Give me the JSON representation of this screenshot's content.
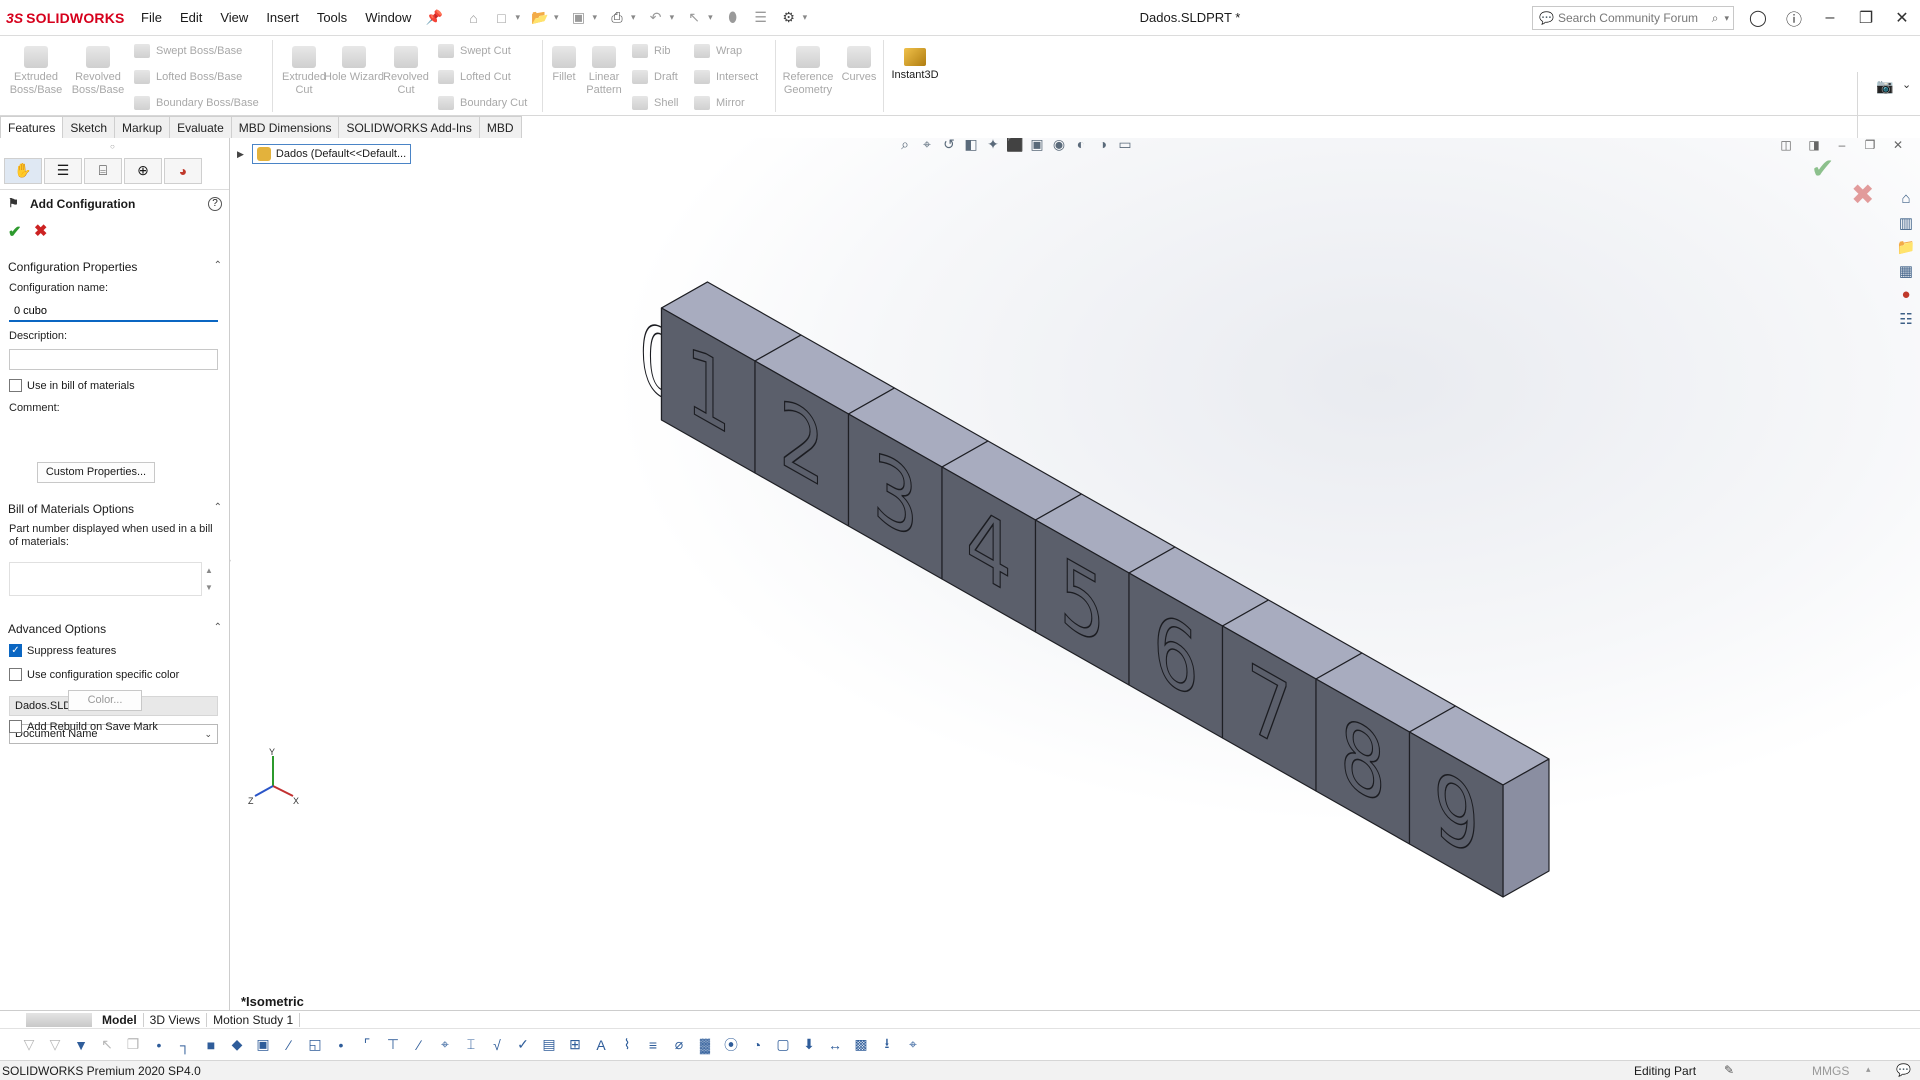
{
  "app": {
    "brand_ds": "3S",
    "brand_name": "SOLIDWORKS",
    "document_title": "Dados.SLDPRT *"
  },
  "menu": [
    "File",
    "Edit",
    "View",
    "Insert",
    "Tools",
    "Window"
  ],
  "search": {
    "placeholder": "Search Community Forum"
  },
  "command_manager": {
    "extruded_boss": "Extruded Boss/Base",
    "revolved_boss": "Revolved Boss/Base",
    "swept_boss": "Swept Boss/Base",
    "lofted_boss": "Lofted Boss/Base",
    "boundary_boss": "Boundary Boss/Base",
    "extruded_cut": "Extruded Cut",
    "hole_wizard": "Hole Wizard",
    "revolved_cut": "Revolved Cut",
    "swept_cut": "Swept Cut",
    "lofted_cut": "Lofted Cut",
    "boundary_cut": "Boundary Cut",
    "fillet": "Fillet",
    "linear_pattern": "Linear Pattern",
    "rib": "Rib",
    "draft": "Draft",
    "shell": "Shell",
    "wrap": "Wrap",
    "intersect": "Intersect",
    "mirror": "Mirror",
    "reference_geometry": "Reference Geometry",
    "curves": "Curves",
    "instant3d": "Instant3D"
  },
  "tabs": [
    "Features",
    "Sketch",
    "Markup",
    "Evaluate",
    "MBD Dimensions",
    "SOLIDWORKS Add-Ins",
    "MBD"
  ],
  "property_manager": {
    "title": "Add Configuration",
    "config_props_heading": "Configuration Properties",
    "config_name_label": "Configuration name:",
    "config_name_value": "0 cubo",
    "description_label": "Description:",
    "use_in_bom_label": "Use in bill of materials",
    "comment_label": "Comment:",
    "custom_props_button": "Custom Properties...",
    "bom_heading": "Bill of Materials Options",
    "part_number_label": "Part number displayed when used in a bill of materials:",
    "part_number_value": "Dados.SLDPRT",
    "part_number_source": "Document Name",
    "advanced_heading": "Advanced Options",
    "suppress_features_label": "Suppress features",
    "suppress_features_checked": true,
    "config_color_label": "Use configuration specific color",
    "color_button": "Color...",
    "rebuild_label": "Add Rebuild on Save Mark"
  },
  "viewport": {
    "tree_node": "Dados  (Default<<Default...",
    "view_name": "*Isometric",
    "digits": [
      "0",
      "1",
      "2",
      "3",
      "4",
      "5",
      "6",
      "7",
      "8",
      "9"
    ],
    "face_color": "#5b5f6b",
    "top_color": "#a8acbf",
    "side_color": "#8a8ea1"
  },
  "triad": {
    "x": "X",
    "y": "Y",
    "z": "Z"
  },
  "bottom_tabs": [
    "Model",
    "3D Views",
    "Motion Study 1"
  ],
  "status": {
    "product": "SOLIDWORKS Premium 2020 SP4.0",
    "mode": "Editing Part",
    "units": "MMGS"
  }
}
